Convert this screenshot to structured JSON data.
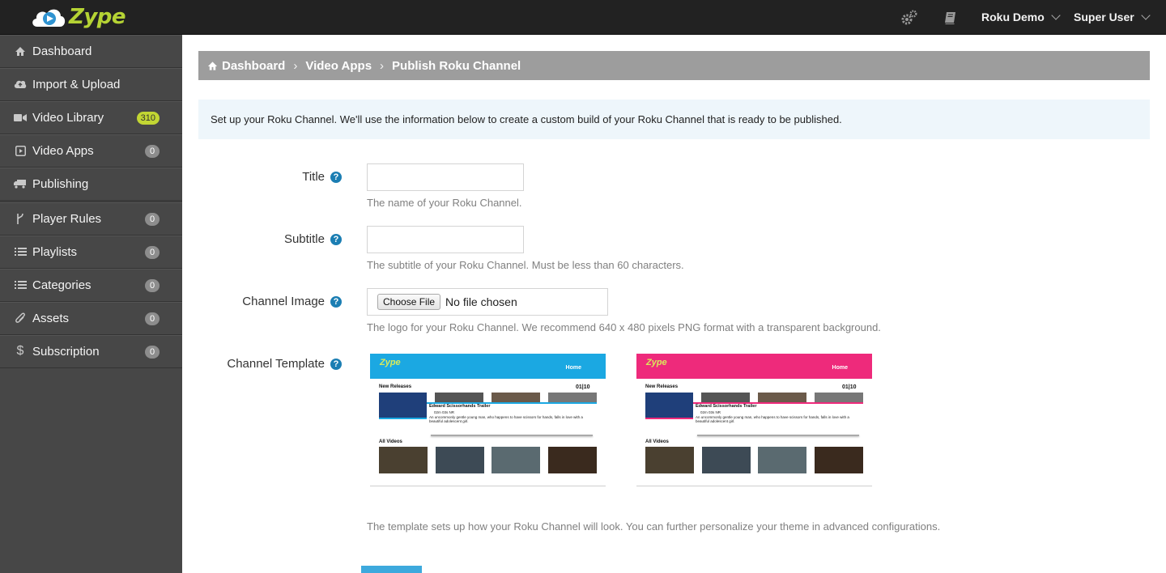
{
  "app": {
    "name": "Zype"
  },
  "topbar": {
    "settings_icon": "gears-icon",
    "docs_icon": "book-icon",
    "account_menu": "Roku Demo",
    "user_menu": "Super User"
  },
  "sidebar": {
    "items": [
      {
        "label": "Dashboard",
        "icon": "home-icon"
      },
      {
        "label": "Import & Upload",
        "icon": "cloud-upload-icon"
      },
      {
        "label": "Video Library",
        "icon": "video-camera-icon",
        "count": "310"
      },
      {
        "label": "Video Apps",
        "icon": "play-square-icon",
        "count": "0"
      },
      {
        "label": "Publishing",
        "icon": "truck-icon"
      },
      {
        "label": "Player Rules",
        "icon": "fork-icon",
        "count": "0"
      },
      {
        "label": "Playlists",
        "icon": "list-icon",
        "count": "0"
      },
      {
        "label": "Categories",
        "icon": "list-icon",
        "count": "0"
      },
      {
        "label": "Assets",
        "icon": "paperclip-icon",
        "count": "0"
      },
      {
        "label": "Subscription",
        "icon": "dollar-icon",
        "count": "0"
      }
    ]
  },
  "breadcrumb": {
    "items": [
      "Dashboard",
      "Video Apps",
      "Publish Roku Channel"
    ],
    "separator": "›"
  },
  "info_text": "Set up your Roku Channel. We'll use the information below to create a custom build of your Roku Channel that is ready to be published.",
  "form": {
    "title": {
      "label": "Title",
      "value": "",
      "hint": "The name of your Roku Channel."
    },
    "subtitle": {
      "label": "Subtitle",
      "value": "",
      "hint": "The subtitle of your Roku Channel. Must be less than 60 characters."
    },
    "channel_image": {
      "label": "Channel Image",
      "button": "Choose File",
      "status": "No file chosen",
      "hint": "The logo for your Roku Channel. We recommend 640 x 480 pixels PNG format with a transparent background."
    },
    "channel_template": {
      "label": "Channel Template",
      "hint": "The template sets up how your Roku Channel will look. You can further personalize your theme in advanced configurations.",
      "preview": {
        "logo": "Zype",
        "nav": "Home",
        "new_releases": "New Releases",
        "counter": "01|10",
        "featured_title": "Edward Scissorhands Trailer",
        "featured_meta": "02m 03s  NR",
        "featured_desc": "An uncommonly gentle young man, who happens to have scissors for hands, falls in love with a beautiful adolescent girl.",
        "all_videos": "All Videos"
      },
      "options": [
        {
          "theme_color": "#1ba8e2"
        },
        {
          "theme_color": "#ee2a7b"
        }
      ]
    }
  },
  "colors": {
    "accent": "#1b7eb3",
    "badge_green": "#c2d633",
    "sidebar": "#474747",
    "topbar": "#222222"
  }
}
